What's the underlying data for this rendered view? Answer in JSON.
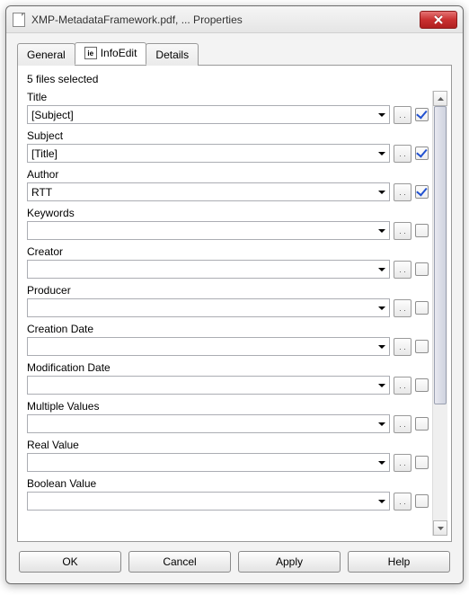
{
  "window": {
    "title": "XMP-MetadataFramework.pdf, ... Properties"
  },
  "tabs": {
    "general": "General",
    "infoedit": "InfoEdit",
    "details": "Details",
    "active": "infoedit",
    "infoedit_icon_text": "ie"
  },
  "status": "5 files selected",
  "fields": [
    {
      "label": "Title",
      "value": "[Subject]",
      "checked": true
    },
    {
      "label": "Subject",
      "value": "[Title]",
      "checked": true
    },
    {
      "label": "Author",
      "value": "RTT",
      "checked": true
    },
    {
      "label": "Keywords",
      "value": "",
      "checked": false
    },
    {
      "label": "Creator",
      "value": "",
      "checked": false
    },
    {
      "label": "Producer",
      "value": "",
      "checked": false
    },
    {
      "label": "Creation Date",
      "value": "",
      "checked": false
    },
    {
      "label": "Modification Date",
      "value": "",
      "checked": false
    },
    {
      "label": "Multiple Values",
      "value": "",
      "checked": false
    },
    {
      "label": "Real Value",
      "value": "",
      "checked": false
    },
    {
      "label": "Boolean Value",
      "value": "",
      "checked": false
    }
  ],
  "action_button_symbol": ". .",
  "buttons": {
    "ok": "OK",
    "cancel": "Cancel",
    "apply": "Apply",
    "help": "Help"
  }
}
